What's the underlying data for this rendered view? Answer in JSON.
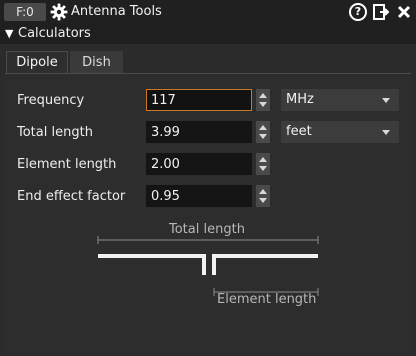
{
  "titlebar": {
    "badge": "F:0",
    "title": "Antenna Tools",
    "icons": [
      "gear-icon",
      "help-icon",
      "detach-icon",
      "close-icon"
    ]
  },
  "section": {
    "label": "Calculators",
    "expanded": true
  },
  "tabs": [
    {
      "label": "Dipole",
      "active": true
    },
    {
      "label": "Dish",
      "active": false
    }
  ],
  "form": {
    "frequency": {
      "label": "Frequency",
      "value": "117",
      "unit": "MHz"
    },
    "total_length": {
      "label": "Total length",
      "value": "3.99",
      "unit": "feet"
    },
    "element_length": {
      "label": "Element length",
      "value": "2.00"
    },
    "end_effect": {
      "label": "End effect factor",
      "value": "0.95"
    }
  },
  "diagram": {
    "total_label": "Total length",
    "element_label": "Element length"
  },
  "colors": {
    "background": "#2b2b2b",
    "field": "#151515",
    "focus_border": "#c67a2a",
    "text": "#eaeaea"
  }
}
